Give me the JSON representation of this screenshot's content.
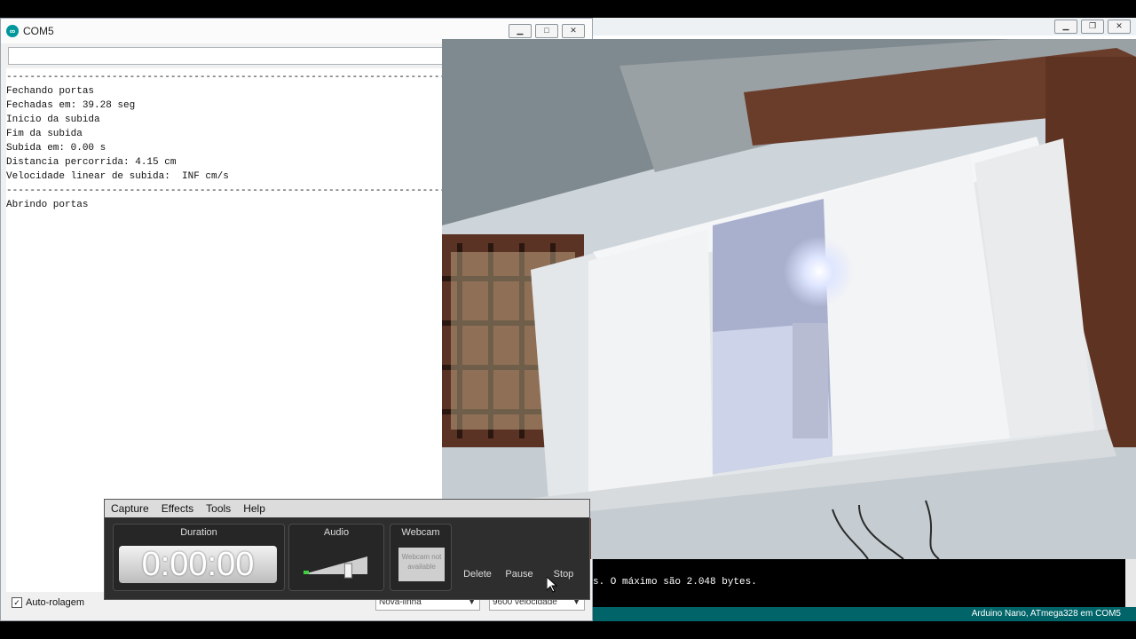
{
  "serial": {
    "title": "COM5",
    "lines": "------------------------------------------------------------------------------------------------------------\nFechando portas\nFechadas em: 39.28 seg\nInicio da subida\nFim da subida\nSubida em: 0.00 s\nDistancia percorrida: 4.15 cm\nVelocidade linear de subida:  INF cm/s\n------------------------------------------------------------------------------------------------------------\nAbrindo portas",
    "autoscroll_label": "Auto-rolagem",
    "line_ending": "Nova-linha",
    "baud": "9600 velocidade"
  },
  "ide": {
    "console_text": "s. O máximo são 2.048 bytes.",
    "status": "Arduino Nano, ATmega328 em COM5"
  },
  "recorder": {
    "menu": [
      "Capture",
      "Effects",
      "Tools",
      "Help"
    ],
    "duration_label": "Duration",
    "duration_value": "0:00:00",
    "audio_label": "Audio",
    "audio_level": 0.7,
    "webcam_label": "Webcam",
    "webcam_status": "Webcam not available",
    "delete_label": "Delete",
    "pause_label": "Pause",
    "stop_label": "Stop"
  },
  "colors": {
    "status_bar": "#006468",
    "arduino_teal": "#00979c"
  }
}
